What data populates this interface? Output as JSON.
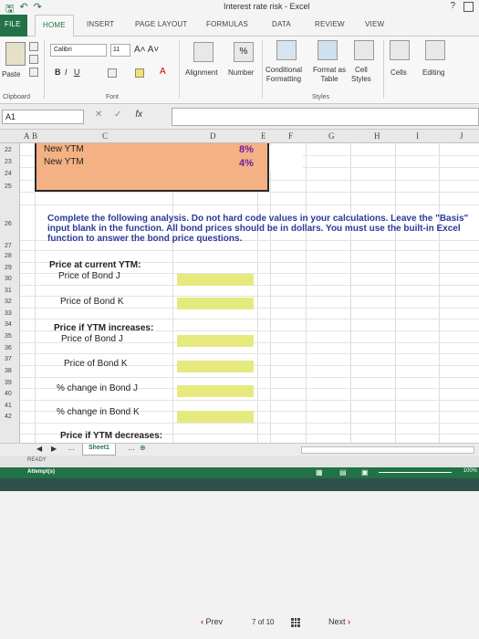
{
  "window": {
    "title": "Interest rate risk - Excel",
    "help": "?"
  },
  "ribbon_tabs": [
    "FILE",
    "HOME",
    "INSERT",
    "PAGE LAYOUT",
    "FORMULAS",
    "DATA",
    "REVIEW",
    "VIEW"
  ],
  "ribbon": {
    "paste": "Paste",
    "clipboard": "Clipboard",
    "font_name": "Calibri",
    "font_size": "11",
    "font_group": "Font",
    "alignment": "Alignment",
    "number": "Number",
    "number_symbol": "%",
    "conditional_formatting": "Conditional\nFormatting",
    "format_as_table": "Format as\nTable",
    "cell_styles": "Cell\nStyles",
    "styles_group": "Styles",
    "cells": "Cells",
    "editing": "Editing",
    "bold": "B",
    "italic": "I",
    "underline": "U"
  },
  "formula_bar": {
    "name_box": "A1",
    "fx": "fx",
    "content": ""
  },
  "columns": [
    "A",
    "B",
    "C",
    "D",
    "E",
    "F",
    "G",
    "H",
    "I",
    "J"
  ],
  "rows": [
    "22",
    "23",
    "24",
    "25",
    "26",
    "27",
    "28",
    "29",
    "30",
    "31",
    "32",
    "33",
    "34",
    "35",
    "36",
    "37",
    "38",
    "39",
    "40",
    "41",
    "42"
  ],
  "cells": {
    "new_ytm_1_label": "New YTM",
    "new_ytm_1_value": "8%",
    "new_ytm_2_label": "New YTM",
    "new_ytm_2_value": "4%",
    "instructions": "Complete the following analysis. Do not hard code values in your calculations. Leave the \"Basis\" input blank in the function. All bond prices should be in dollars. You must use the built-in Excel function to answer the bond price questions.",
    "price_current_header": "Price at current YTM:",
    "price_bond_j_1": "Price of Bond J",
    "price_bond_k_1": "Price of Bond K",
    "ytm_increases_header": "Price if YTM increases:",
    "price_bond_j_2": "Price of Bond J",
    "price_bond_k_2": "Price of Bond K",
    "pct_change_j": "% change in Bond J",
    "pct_change_k": "% change in Bond K",
    "ytm_decreases_header": "Price if YTM decreases:"
  },
  "sheet_tab": "Sheet1",
  "status": {
    "ready": "READY",
    "attempt": "Attempt(s)",
    "zoom": "100%"
  },
  "footer_nav": {
    "prev": "Prev",
    "page": "7",
    "of": "of",
    "total": "10",
    "next": "Next"
  },
  "colors": {
    "excel_green": "#217346",
    "orange_fill": "#f4b183",
    "yellow_fill": "#e6ea7e",
    "ytm_value": "#6b1fa8",
    "instruction_text": "#2a3a98"
  }
}
